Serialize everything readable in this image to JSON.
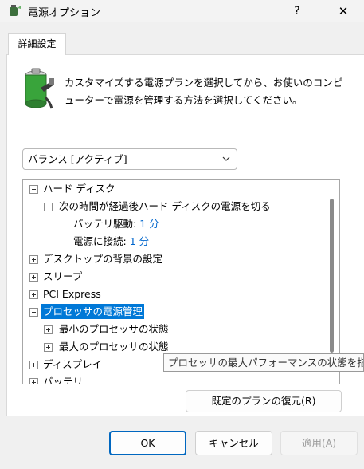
{
  "window": {
    "title": "電源オプション",
    "help": "?",
    "close": "✕"
  },
  "tab": {
    "label": "詳細設定"
  },
  "description": "カスタマイズする電源プランを選択してから、お使いのコンピューターで電源を管理する方法を選択してください。",
  "plan_select": {
    "value": "バランス [アクティブ]"
  },
  "tree": {
    "hard_disk": "ハード ディスク",
    "turn_off": "次の時間が経過後ハード ディスクの電源を切る",
    "on_battery_label": "バッテリ駆動:",
    "on_battery_value": "1 分",
    "plugged_label": "電源に接続:",
    "plugged_value": "1 分",
    "desktop_bg": "デスクトップの背景の設定",
    "sleep": "スリープ",
    "pci": "PCI Express",
    "processor": "プロセッサの電源管理",
    "min_state": "最小のプロセッサの状態",
    "max_state": "最大のプロセッサの状態",
    "display": "ディスプレイ",
    "battery": "バッテリ"
  },
  "tooltip": "プロセッサの最大パフォーマンスの状態を指定",
  "restore_button": "既定のプランの復元(R)",
  "buttons": {
    "ok": "OK",
    "cancel": "キャンセル",
    "apply": "適用(A)"
  },
  "colors": {
    "accent": "#0078d7",
    "link": "#0066cc",
    "ok_border": "#0067c0"
  }
}
